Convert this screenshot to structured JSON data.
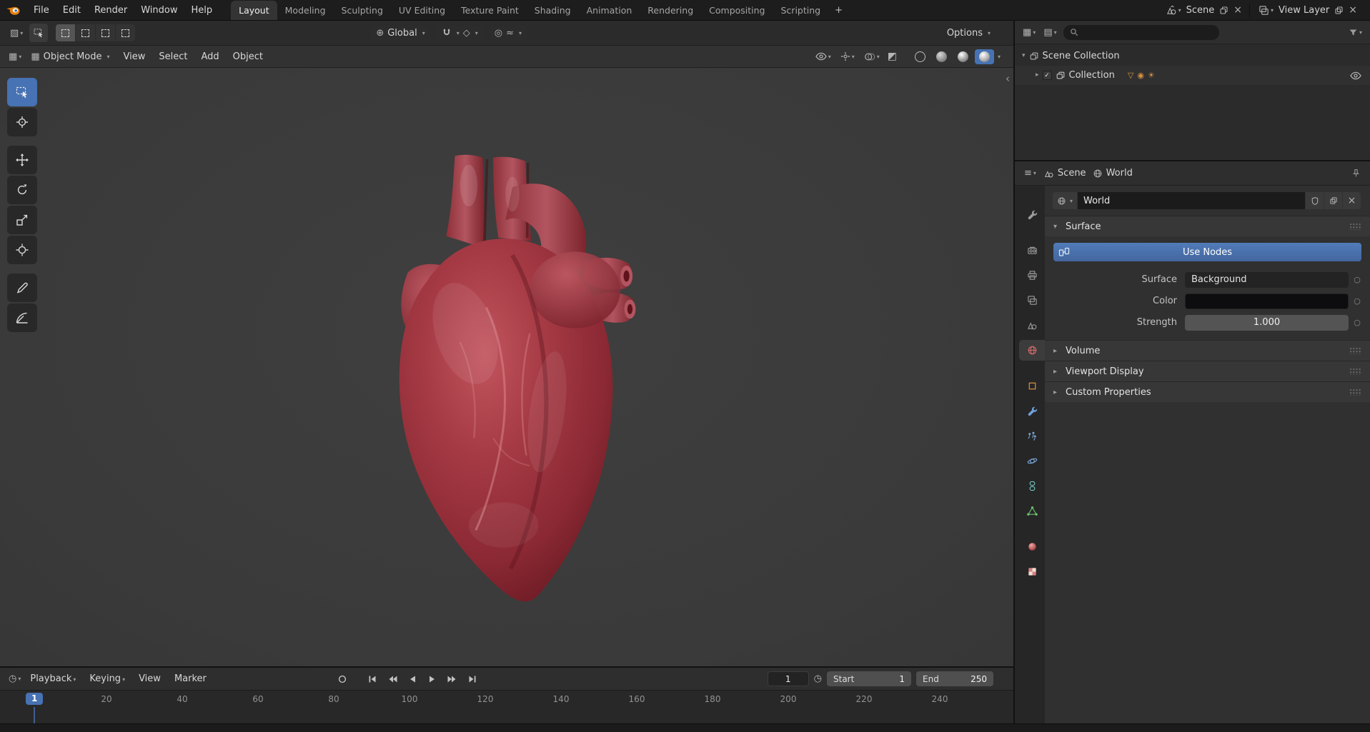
{
  "topbar": {
    "menus": [
      "File",
      "Edit",
      "Render",
      "Window",
      "Help"
    ],
    "workspaces": [
      "Layout",
      "Modeling",
      "Sculpting",
      "UV Editing",
      "Texture Paint",
      "Shading",
      "Animation",
      "Rendering",
      "Compositing",
      "Scripting"
    ],
    "add_workspace_label": "+",
    "scene_selector_label": "Scene",
    "view_layer_selector_label": "View Layer"
  },
  "tool_settings": {
    "orientation_value": "Global",
    "options_label": "Options"
  },
  "viewport": {
    "mode_value": "Object Mode",
    "menus": [
      "View",
      "Select",
      "Add",
      "Object"
    ]
  },
  "outliner": {
    "scene_collection_label": "Scene Collection",
    "collection_label": "Collection"
  },
  "properties": {
    "breadcrumb_scene": "Scene",
    "breadcrumb_world": "World",
    "world_name_value": "World",
    "surface_panel_title": "Surface",
    "use_nodes_label": "Use Nodes",
    "surface_label": "Surface",
    "surface_value": "Background",
    "color_label": "Color",
    "strength_label": "Strength",
    "strength_value": "1.000",
    "collapsed_panels": [
      "Volume",
      "Viewport Display",
      "Custom Properties"
    ]
  },
  "timeline": {
    "menus": [
      "Playback",
      "Keying",
      "View",
      "Marker"
    ],
    "current_frame_value": "1",
    "start_label": "Start",
    "start_value": "1",
    "end_label": "End",
    "end_value": "250",
    "playhead_label": "1",
    "ruler_ticks": [
      "20",
      "40",
      "60",
      "80",
      "100",
      "120",
      "140",
      "160",
      "180",
      "200",
      "220",
      "240"
    ]
  },
  "icons": {
    "chevron_down": "▾",
    "disclosure_expanded": "▾",
    "disclosure_collapsed": "▸",
    "close": "×",
    "check": "✓",
    "decorator_dot": "○",
    "clock": "◷",
    "proportional": "◎",
    "falloff": "≈",
    "orientation": "⊕",
    "xray": "◩",
    "editor_viewport": "▧",
    "editor_grid": "▦",
    "editor_image": "▤",
    "editor_properties": "≡",
    "sidebar_toggle": "‹",
    "filter_mesh": "▽",
    "filter_camera": "◉",
    "filter_light": "☀",
    "snap_to": "◇"
  },
  "colors": {
    "accent": "#4772b3",
    "viewport_background": "#3a3a3a",
    "heart_base": "#a03540",
    "collection_filter_orange": "#d9923f"
  }
}
